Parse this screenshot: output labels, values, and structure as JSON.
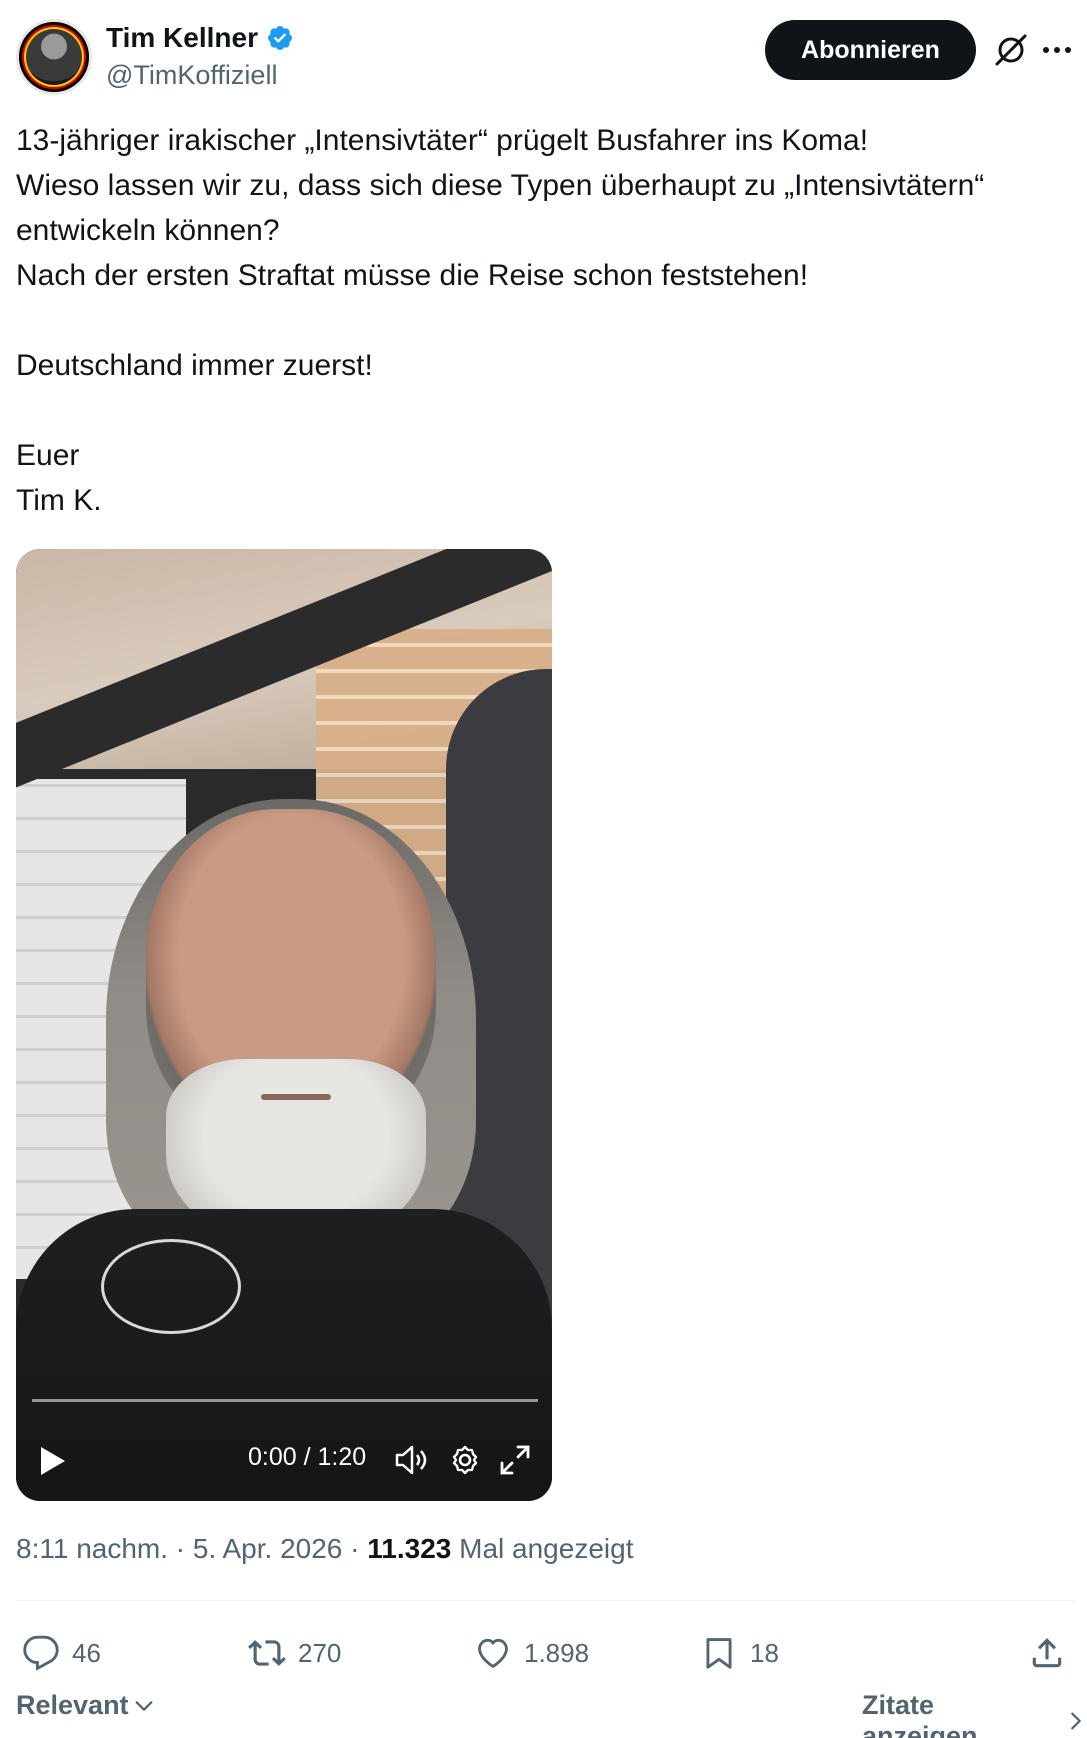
{
  "header": {
    "display_name": "Tim Kellner",
    "handle": "@TimKoffiziell",
    "subscribe_label": "Abonnieren"
  },
  "tweet": {
    "lines": [
      "13-jähriger irakischer „Intensivtäter“ prügelt Busfahrer ins Koma!",
      "Wieso lassen wir zu, dass sich diese Typen überhaupt zu „Intensivtätern“",
      "entwickeln können?",
      "Nach der ersten Straftat müsse die Reise schon feststehen!",
      "Deutschland immer zuerst!",
      "Euer",
      "Tim K."
    ]
  },
  "video": {
    "time_display": "0:00 / 1:20",
    "progress": 0
  },
  "meta": {
    "timestamp": "8:11 nachm. · 5. Apr. 2026 · ",
    "views_count": "11.323",
    "views_label": " Mal angezeigt"
  },
  "actions": {
    "replies": "46",
    "reposts": "270",
    "likes": "1.898",
    "bookmarks": "18"
  },
  "footer": {
    "sort_label": "Relevant",
    "quotes_label": "Zitate anzeigen"
  },
  "colors": {
    "text_primary": "#0f1419",
    "text_secondary": "#536471",
    "verified_blue": "#1d9bf0",
    "button_bg": "#0f1419"
  },
  "icons": [
    "verified-badge-icon",
    "grok-icon",
    "more-icon",
    "play-icon",
    "volume-icon",
    "settings-icon",
    "fullscreen-icon",
    "reply-icon",
    "repost-icon",
    "like-icon",
    "bookmark-icon",
    "share-icon",
    "chevron-down-icon",
    "chevron-right-icon"
  ]
}
